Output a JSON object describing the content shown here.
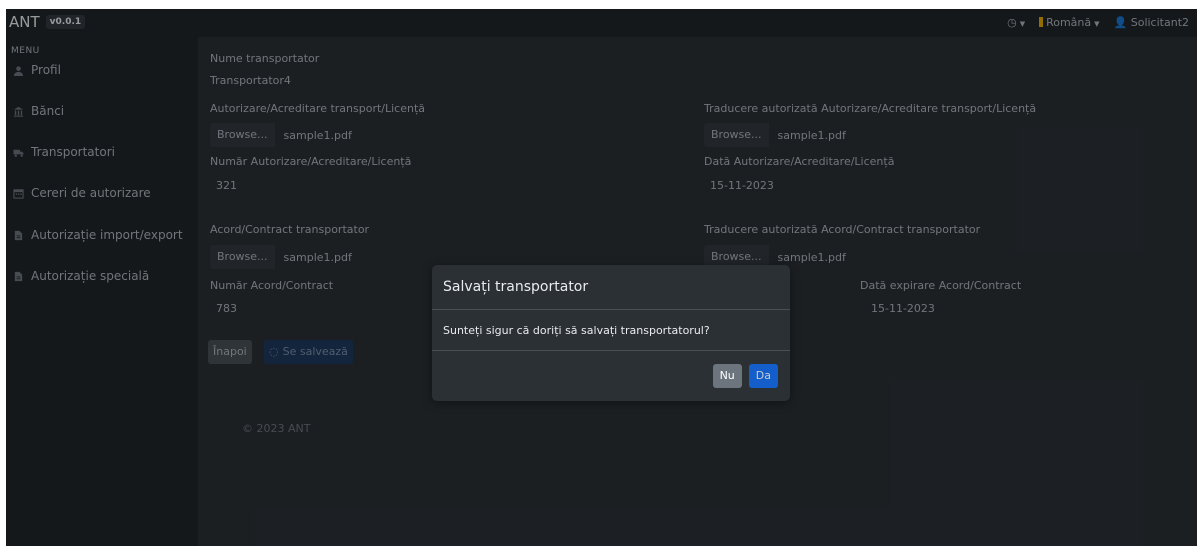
{
  "navbar": {
    "brand": "ANT",
    "version": "v0.0.1",
    "language": "Română",
    "user": "Solicitant2"
  },
  "sidebar": {
    "menu_title": "MENU",
    "items": [
      {
        "label": "Profil",
        "icon": "user-icon"
      },
      {
        "label": "Bănci",
        "icon": "bank-icon"
      },
      {
        "label": "Transportatori",
        "icon": "truck-icon"
      },
      {
        "label": "Cereri de autorizare",
        "icon": "calendar-icon"
      },
      {
        "label": "Autorizație import/export",
        "icon": "file-icon"
      },
      {
        "label": "Autorizație specială",
        "icon": "file-icon"
      }
    ]
  },
  "form": {
    "name_label": "Nume transportator",
    "name_value": "Transportator4",
    "auth_label": "Autorizare/Acreditare transport/Licență",
    "auth_browse": "Browse...",
    "auth_file": "sample1.pdf",
    "auth_tr_label": "Traducere autorizată Autorizare/Acreditare transport/Licență",
    "auth_tr_browse": "Browse...",
    "auth_tr_file": "sample1.pdf",
    "auth_num_label": "Număr Autorizare/Acreditare/Licență",
    "auth_num_value": "321",
    "auth_date_label": "Dată Autorizare/Acreditare/Licență",
    "auth_date_value": "15-11-2023",
    "contract_label": "Acord/Contract transportator",
    "contract_browse": "Browse...",
    "contract_file": "sample1.pdf",
    "contract_tr_label": "Traducere autorizată Acord/Contract transportator",
    "contract_tr_browse": "Browse...",
    "contract_tr_file": "sample1.pdf",
    "contract_num_label": "Număr Acord/Contract",
    "contract_num_value": "783",
    "contract_exp_label": "Dată expirare Acord/Contract",
    "contract_exp_value": "15-11-2023",
    "back_label": "Înapoi",
    "saving_label": "Se salvează"
  },
  "footer": {
    "text": "© 2023 ANT"
  },
  "modal": {
    "title": "Salvați transportator",
    "body": "Sunteți sigur că doriți să salvați transportatorul?",
    "no_label": "Nu",
    "yes_label": "Da"
  }
}
